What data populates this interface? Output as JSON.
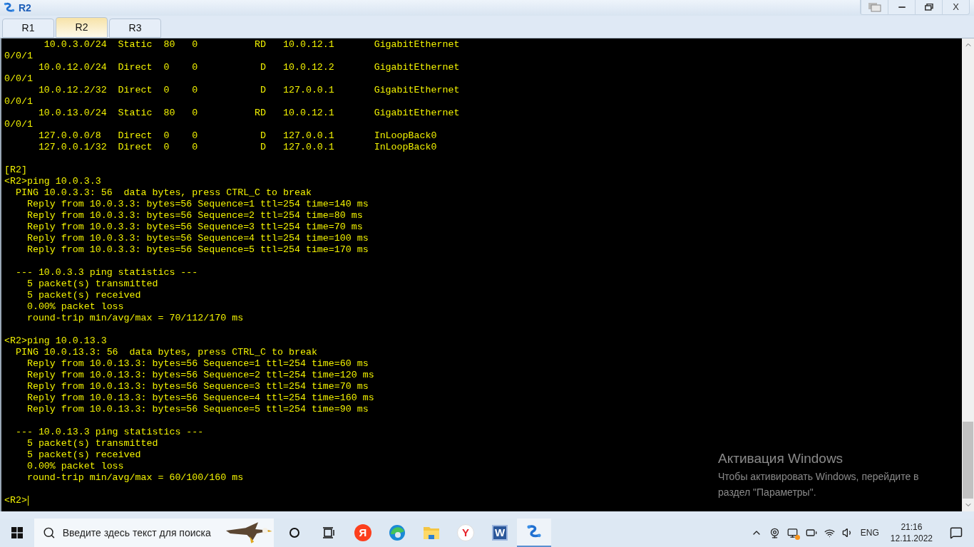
{
  "window": {
    "title": "R2",
    "controls": [
      {
        "kind": "restore-window"
      },
      {
        "kind": "minimize"
      },
      {
        "kind": "maximize"
      },
      {
        "kind": "close",
        "glyph": "X"
      }
    ]
  },
  "tabs": [
    {
      "label": "R1",
      "selected": false
    },
    {
      "label": "R2",
      "selected": true
    },
    {
      "label": "R3",
      "selected": false
    }
  ],
  "terminal": {
    "blocks": [
      [
        "       10.0.3.0/24  Static  80   0          RD   10.0.12.1       GigabitEthernet",
        "0/0/1",
        "      10.0.12.0/24  Direct  0    0           D   10.0.12.2       GigabitEthernet",
        "0/0/1",
        "      10.0.12.2/32  Direct  0    0           D   127.0.0.1       GigabitEthernet",
        "0/0/1",
        "      10.0.13.0/24  Static  80   0          RD   10.0.12.1       GigabitEthernet",
        "0/0/1",
        "      127.0.0.0/8   Direct  0    0           D   127.0.0.1       InLoopBack0",
        "      127.0.0.1/32  Direct  0    0           D   127.0.0.1       InLoopBack0"
      ],
      [
        "[R2]",
        "<R2>ping 10.0.3.3",
        "  PING 10.0.3.3: 56  data bytes, press CTRL_C to break",
        "    Reply from 10.0.3.3: bytes=56 Sequence=1 ttl=254 time=140 ms",
        "    Reply from 10.0.3.3: bytes=56 Sequence=2 ttl=254 time=80 ms",
        "    Reply from 10.0.3.3: bytes=56 Sequence=3 ttl=254 time=70 ms",
        "    Reply from 10.0.3.3: bytes=56 Sequence=4 ttl=254 time=100 ms",
        "    Reply from 10.0.3.3: bytes=56 Sequence=5 ttl=254 time=170 ms"
      ],
      [
        "  --- 10.0.3.3 ping statistics ---",
        "    5 packet(s) transmitted",
        "    5 packet(s) received",
        "    0.00% packet loss",
        "    round-trip min/avg/max = 70/112/170 ms"
      ],
      [
        "<R2>ping 10.0.13.3",
        "  PING 10.0.13.3: 56  data bytes, press CTRL_C to break",
        "    Reply from 10.0.13.3: bytes=56 Sequence=1 ttl=254 time=60 ms",
        "    Reply from 10.0.13.3: bytes=56 Sequence=2 ttl=254 time=120 ms",
        "    Reply from 10.0.13.3: bytes=56 Sequence=3 ttl=254 time=70 ms",
        "    Reply from 10.0.13.3: bytes=56 Sequence=4 ttl=254 time=160 ms",
        "    Reply from 10.0.13.3: bytes=56 Sequence=5 ttl=254 time=90 ms"
      ],
      [
        "  --- 10.0.13.3 ping statistics ---",
        "    5 packet(s) transmitted",
        "    5 packet(s) received",
        "    0.00% packet loss",
        "    round-trip min/avg/max = 60/100/160 ms"
      ],
      [
        "<R2>"
      ]
    ]
  },
  "activation": {
    "title": "Активация Windows",
    "text": "Чтобы активировать Windows, перейдите в раздел \"Параметры\"."
  },
  "taskbar": {
    "search": {
      "placeholder": "Введите здесь текст для поиска"
    },
    "apps": [
      {
        "kind": "cortana",
        "selected": false
      },
      {
        "kind": "taskview",
        "selected": false
      },
      {
        "kind": "yandex",
        "glyph": "Я",
        "selected": false
      },
      {
        "kind": "edge",
        "selected": false
      },
      {
        "kind": "explorer",
        "selected": false
      },
      {
        "kind": "ybrowser",
        "glyph": "Y",
        "selected": false
      },
      {
        "kind": "word",
        "glyph": "W",
        "selected": false
      },
      {
        "kind": "ensp",
        "selected": true
      }
    ],
    "language": "ENG",
    "time": "21:16",
    "date": "12.11.2022"
  }
}
